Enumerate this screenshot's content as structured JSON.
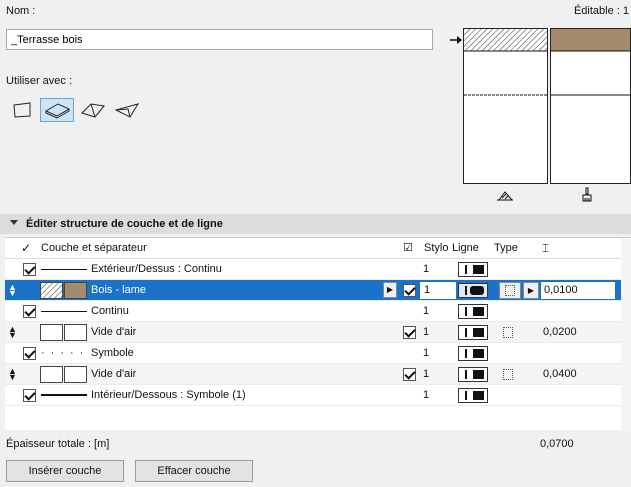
{
  "name_label": "Nom :",
  "editable_label": "Éditable : 1",
  "name_value": "_Terrasse bois",
  "use_with_label": "Utiliser avec :",
  "use_icons": [
    "wall-icon",
    "slab-icon",
    "roof-icon",
    "shell-icon"
  ],
  "section_title": "Éditer structure de couche et de ligne",
  "columns": {
    "layer": "Couche et séparateur",
    "pen": "Stylo",
    "line": "Ligne",
    "type": "Type",
    "thickness_icon": "thickness-icon"
  },
  "rows": [
    {
      "kind": "line",
      "label": "Extérieur/Dessus : Continu",
      "pen": "1"
    },
    {
      "kind": "layer",
      "label": "Bois - lame",
      "pen": "1",
      "thickness": "0,0100",
      "selected": true
    },
    {
      "kind": "line",
      "label": "Continu",
      "pen": "1"
    },
    {
      "kind": "layer",
      "label": "Vide d'air",
      "pen": "1",
      "thickness": "0,0200"
    },
    {
      "kind": "line",
      "label": "Symbole",
      "pen": "1"
    },
    {
      "kind": "layer",
      "label": "Vide d'air",
      "pen": "1",
      "thickness": "0,0400"
    },
    {
      "kind": "line",
      "label": "Intérieur/Dessous : Symbole (1)",
      "pen": "1"
    }
  ],
  "total_label": "Épaisseur totale : [m]",
  "total_value": "0,0700",
  "buttons": {
    "insert": "Insérer couche",
    "delete": "Effacer couche"
  },
  "colors": {
    "wood": "#a68a6d",
    "selection": "#1a73c8"
  }
}
